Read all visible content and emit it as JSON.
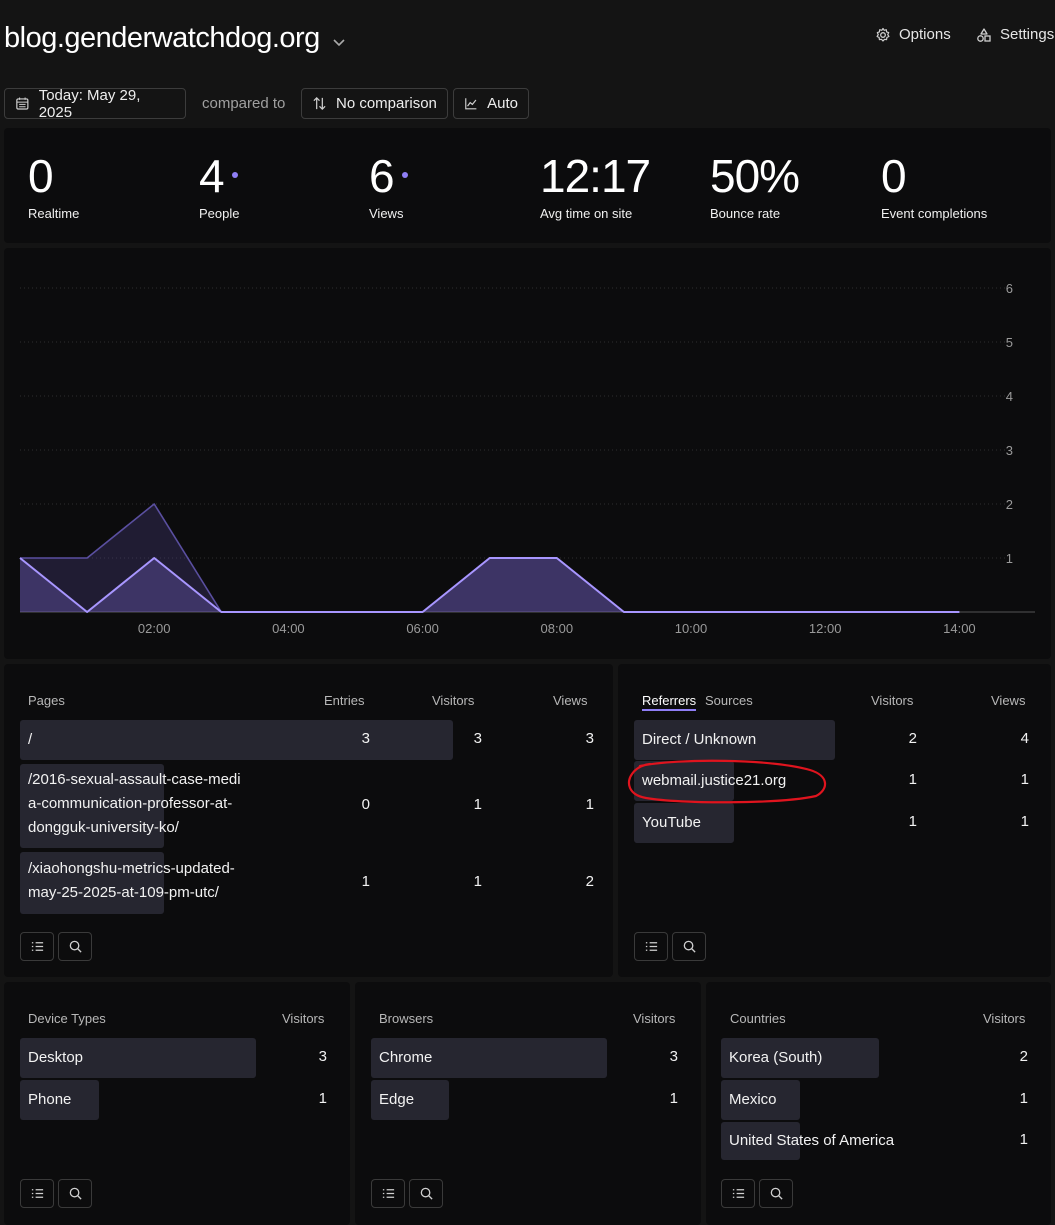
{
  "header": {
    "site": "blog.genderwatchdog.org",
    "options_label": "Options",
    "settings_label": "Settings"
  },
  "toolbar": {
    "date_label": "Today: May 29, 2025",
    "compared_to": "compared to",
    "comparison_label": "No comparison",
    "interval_label": "Auto"
  },
  "metrics": [
    {
      "value": "0",
      "label": "Realtime"
    },
    {
      "value": "4",
      "label": "People"
    },
    {
      "value": "6",
      "label": "Views"
    },
    {
      "value": "12:17",
      "label": "Avg time on site"
    },
    {
      "value": "50%",
      "label": "Bounce rate"
    },
    {
      "value": "0",
      "label": "Event completions"
    }
  ],
  "chart_data": {
    "type": "area",
    "x": [
      "00:00",
      "01:00",
      "02:00",
      "03:00",
      "04:00",
      "05:00",
      "06:00",
      "07:00",
      "08:00",
      "09:00",
      "10:00",
      "11:00",
      "12:00",
      "13:00",
      "14:00",
      "15:00"
    ],
    "x_tick_labels": [
      "02:00",
      "04:00",
      "06:00",
      "08:00",
      "10:00",
      "12:00",
      "14:00"
    ],
    "y_tick_labels": [
      "1",
      "2",
      "3",
      "4",
      "5",
      "6"
    ],
    "ylim": [
      0,
      6
    ],
    "series": [
      {
        "values": [
          1,
          1,
          2,
          0,
          0,
          0,
          0,
          1,
          1,
          0,
          0,
          0,
          0,
          0,
          0,
          0
        ],
        "color": "#5a4fa0"
      },
      {
        "values": [
          1,
          0,
          1,
          0,
          0,
          0,
          0,
          1,
          1,
          0,
          0,
          0,
          0,
          0,
          0,
          0
        ],
        "color": "#a896ff"
      }
    ],
    "grid": true
  },
  "pages": {
    "title": "Pages",
    "col_entries": "Entries",
    "col_visitors": "Visitors",
    "col_views": "Views",
    "rows": [
      {
        "label": "/",
        "entries": "3",
        "visitors": "3",
        "views": "3"
      },
      {
        "label_lines": [
          "/2016-sexual-assault-case-medi",
          "a-communication-professor-at-",
          "dongguk-university-ko/"
        ],
        "entries": "0",
        "visitors": "1",
        "views": "1"
      },
      {
        "label_lines": [
          "/xiaohongshu-metrics-updated-",
          "may-25-2025-at-109-pm-utc/"
        ],
        "entries": "1",
        "visitors": "1",
        "views": "2"
      }
    ]
  },
  "referrers": {
    "tab_referrers": "Referrers",
    "tab_sources": "Sources",
    "col_visitors": "Visitors",
    "col_views": "Views",
    "rows": [
      {
        "label": "Direct / Unknown",
        "visitors": "2",
        "views": "4"
      },
      {
        "label": "webmail.justice21.org",
        "visitors": "1",
        "views": "1"
      },
      {
        "label": "YouTube",
        "visitors": "1",
        "views": "1"
      }
    ]
  },
  "devices": {
    "title": "Device Types",
    "col_visitors": "Visitors",
    "rows": [
      {
        "label": "Desktop",
        "visitors": "3"
      },
      {
        "label": "Phone",
        "visitors": "1"
      }
    ]
  },
  "browsers": {
    "title": "Browsers",
    "col_visitors": "Visitors",
    "rows": [
      {
        "label": "Chrome",
        "visitors": "3"
      },
      {
        "label": "Edge",
        "visitors": "1"
      }
    ]
  },
  "countries": {
    "title": "Countries",
    "col_visitors": "Visitors",
    "rows": [
      {
        "label": "Korea (South)",
        "visitors": "2"
      },
      {
        "label": "Mexico",
        "visitors": "1"
      },
      {
        "label": "United States of America",
        "visitors": "1"
      }
    ]
  },
  "colors": {
    "accent": "#8f7ef5",
    "annotation": "#e0141e",
    "background": "#141414",
    "panel": "#0c0c0d"
  }
}
